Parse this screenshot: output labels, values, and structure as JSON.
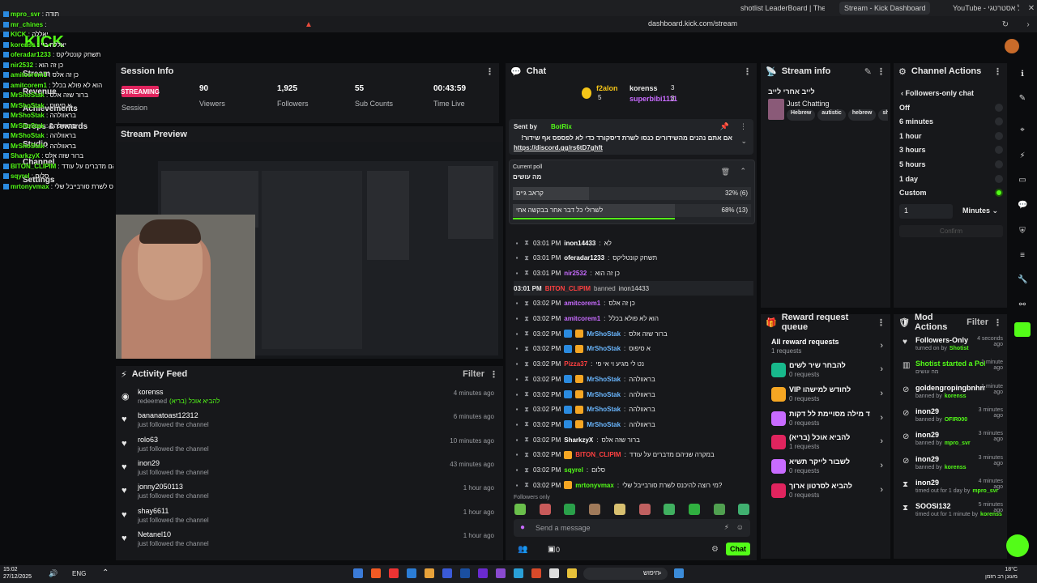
{
  "browser": {
    "tabs": [
      {
        "label": "shotlist LeaderBoard | The best Chatti"
      },
      {
        "label": "Stream - Kick Dashboard"
      },
      {
        "label": "YouTube - פריסטייל אסטרטגי"
      }
    ],
    "url": "dashboard.kick.com/stream"
  },
  "session": {
    "title": "Session Info",
    "status": "STREAMING",
    "status_label": "Session",
    "stats": [
      {
        "value": "90",
        "label": "Viewers"
      },
      {
        "value": "1,925",
        "label": "Followers"
      },
      {
        "value": "55",
        "label": "Sub Counts"
      },
      {
        "value": "00:43:59",
        "label": "Time Live"
      }
    ]
  },
  "preview": {
    "title": "Stream Preview"
  },
  "sidebar_overlay": {
    "logo": "KICK",
    "menu": [
      "Stream",
      "Revenue",
      "Achievements",
      "Drops & rewards",
      "Studio",
      "Channel",
      "Settings"
    ],
    "lines": [
      {
        "user": "mpro_svr",
        "text": "תודה"
      },
      {
        "user": "mr_chines",
        "text": ""
      },
      {
        "user": "KICK",
        "text": "יאללה"
      },
      {
        "user": "korenss",
        "text": "יאללה ביי"
      },
      {
        "user": "oferadar1233",
        "text": "תשחק קונטליקס"
      },
      {
        "user": "nir2532",
        "text": "כן זה הוא"
      },
      {
        "user": "amitcorem1",
        "text": "כן זה אלס"
      },
      {
        "user": "amitcorem1",
        "text": "הוא לא פולא בכלל"
      },
      {
        "user": "MrShoStak",
        "text": "ברור שזה אלס"
      },
      {
        "user": "MrShoStak",
        "text": "א סיפוס"
      },
      {
        "user": "MrShoStak",
        "text": "בראוולהה"
      },
      {
        "user": "MrShoStak",
        "text": "בראוולהה"
      },
      {
        "user": "MrShoStak",
        "text": "בראוולהה"
      },
      {
        "user": "MrShoStak",
        "text": "בראוולהה"
      },
      {
        "user": "SharkzyX",
        "text": "ברור שזה אלס"
      },
      {
        "user": "BITON_CLIPIM",
        "text": "במקרה שניהם מדברים על עודד"
      },
      {
        "user": "sqyrel",
        "text": "סלום"
      },
      {
        "user": "mrtonyvmax",
        "text": "מי רוצה להיכנס לשרת סורבייבל שלי?"
      }
    ]
  },
  "activity": {
    "title": "Activity Feed",
    "filter": "Filter",
    "items": [
      {
        "name": "korenss",
        "sub": "redeemed",
        "reward": "להביא אוכל (בריא)",
        "time": "4 minutes ago"
      },
      {
        "name": "bananatoast12312",
        "sub": "just followed the channel",
        "time": "6 minutes ago"
      },
      {
        "name": "rolo63",
        "sub": "just followed the channel",
        "time": "10 minutes ago"
      },
      {
        "name": "inon29",
        "sub": "just followed the channel",
        "time": "43 minutes ago"
      },
      {
        "name": "jonny2050113",
        "sub": "just followed the channel",
        "time": "1 hour ago"
      },
      {
        "name": "shay6611",
        "sub": "just followed the channel",
        "time": "1 hour ago"
      },
      {
        "name": "Netanel10",
        "sub": "just followed the channel",
        "time": "1 hour ago"
      }
    ]
  },
  "chat": {
    "title": "Chat",
    "leaderboard": [
      {
        "name": "f2alon",
        "count": "5"
      },
      {
        "name": "korenss",
        "count": "3"
      },
      {
        "name": "superbibi1111",
        "count": "3"
      }
    ],
    "pinned": {
      "sent_by": "Sent by",
      "bot": "BotRix",
      "text": "!אם אתם נהנים מהשידורים כנסו לשרת דיסקורד כדי לא לפספס אף שידור",
      "link": "https://discord.gg/rs6tD7ghft"
    },
    "poll": {
      "label": "Current poll",
      "question": "מה עושים",
      "options": [
        {
          "text": "קראב גיים",
          "result": "32% (6)",
          "pct": 32
        },
        {
          "text": "לשרולי כל דבר אחר בבקשה אחי",
          "result": "68% (13)",
          "pct": 68
        }
      ]
    },
    "messages": [
      {
        "time": "03:01 PM",
        "user": "inon14433",
        "color": "#ffffff",
        "text": "לא",
        "badges": []
      },
      {
        "time": "03:01 PM",
        "user": "oferadar1233",
        "color": "#ffffff",
        "text": "תשחק קונטליקס",
        "badges": []
      },
      {
        "time": "03:01 PM",
        "user": "nir2532",
        "color": "#c86bff",
        "text": "כן זה הוא",
        "badges": []
      },
      {
        "system": true,
        "time": "03:01 PM",
        "actor": "BITON_CLIPIM",
        "action": "banned",
        "target": "inon14433"
      },
      {
        "time": "03:02 PM",
        "user": "amitcorem1",
        "color": "#c86bff",
        "text": "כן זה אלס",
        "badges": []
      },
      {
        "time": "03:02 PM",
        "user": "amitcorem1",
        "color": "#c86bff",
        "text": "הוא לא פולא בכלל",
        "badges": []
      },
      {
        "time": "03:02 PM",
        "user": "MrShoStak",
        "color": "#6ab7ff",
        "text": "ברור שזה אלס",
        "badges": [
          "b",
          "o"
        ]
      },
      {
        "time": "03:02 PM",
        "user": "MrShoStak",
        "color": "#6ab7ff",
        "text": "א סיפוס",
        "badges": [
          "b",
          "o"
        ]
      },
      {
        "time": "03:02 PM",
        "user": "Pizza37",
        "color": "#ff4040",
        "text": "נט לי מגיע וי אי פי",
        "badges": []
      },
      {
        "time": "03:02 PM",
        "user": "MrShoStak",
        "color": "#6ab7ff",
        "text": "בראוולהה",
        "badges": [
          "b",
          "o"
        ]
      },
      {
        "time": "03:02 PM",
        "user": "MrShoStak",
        "color": "#6ab7ff",
        "text": "בראוולהה",
        "badges": [
          "b",
          "o"
        ]
      },
      {
        "time": "03:02 PM",
        "user": "MrShoStak",
        "color": "#6ab7ff",
        "text": "בראוולהה",
        "badges": [
          "b",
          "o"
        ]
      },
      {
        "time": "03:02 PM",
        "user": "MrShoStak",
        "color": "#6ab7ff",
        "text": "בראוולהה",
        "badges": [
          "b",
          "o"
        ]
      },
      {
        "time": "03:02 PM",
        "user": "SharkzyX",
        "color": "#ffffff",
        "text": "ברור שזה אלס",
        "badges": []
      },
      {
        "time": "03:02 PM",
        "user": "BITON_CLIPIM",
        "color": "#ff4040",
        "text": "במקרה שניהם מדברים על עודד",
        "badges": [
          "o"
        ]
      },
      {
        "time": "03:02 PM",
        "user": "sqyrel",
        "color": "#53fc18",
        "text": "סלום",
        "badges": []
      },
      {
        "time": "03:02 PM",
        "user": "mrtonyvmax",
        "color": "#53fc18",
        "text": "מי רוצה להיכנס לשרת סורבייבל שלי?",
        "badges": [
          "o"
        ]
      }
    ],
    "followers_only": "Followers only",
    "placeholder": "Send a message",
    "count": "0",
    "send": "Chat"
  },
  "stream_info": {
    "title": "Stream info",
    "stream_title": "לייב אחרי לייב",
    "category": "Just Chatting",
    "tags": [
      "Hebrew",
      "autistic",
      "hebrew",
      "sh"
    ]
  },
  "channel_actions": {
    "title": "Channel Actions",
    "sub": "Followers-only chat",
    "options": [
      "Off",
      "6 minutes",
      "1 hour",
      "3 hours",
      "5 hours",
      "1 day",
      "Custom"
    ],
    "selected": "Custom",
    "custom_value": "1",
    "unit": "Minutes",
    "confirm": "Confirm"
  },
  "reward_queue": {
    "title": "Reward request queue",
    "all": {
      "name": "All reward requests",
      "sub": "1 requests"
    },
    "items": [
      {
        "name": "להבחר שיר לשים",
        "sub": "0 requests",
        "color": "#18b98c"
      },
      {
        "name": "VIP לחודש למישהו",
        "sub": "0 requests",
        "color": "#f5a623"
      },
      {
        "name": "להגיד מילה מסויימת לל דקות",
        "sub": "0 requests",
        "color": "#c86bff"
      },
      {
        "name": "להביא אוכל (בריא)",
        "sub": "1 requests",
        "color": "#e0245e"
      },
      {
        "name": "לשבור לייקר תשיא",
        "sub": "0 requests",
        "color": "#c86bff"
      },
      {
        "name": "להביא לסרטון ארוך",
        "sub": "0 requests",
        "color": "#e0245e"
      }
    ]
  },
  "mod_actions": {
    "title": "Mod Actions",
    "filter": "Filter",
    "items": [
      {
        "icon": "heart",
        "name": "Followers-Only",
        "sub": "turned on by",
        "by": "Shotist",
        "time": "4 seconds ago"
      },
      {
        "icon": "poll",
        "name": "Shotist started a Poll",
        "sub": "מה עושים",
        "by": "",
        "time": "1 minute ago"
      },
      {
        "icon": "ban",
        "name": "goldengropingbnhmlb",
        "sub": "banned by",
        "by": "korenss",
        "time": "1 minute ago"
      },
      {
        "icon": "ban",
        "name": "inon29",
        "sub": "banned by",
        "by": "OFIR000",
        "time": "3 minutes ago"
      },
      {
        "icon": "ban",
        "name": "inon29",
        "sub": "banned by",
        "by": "mpro_svr",
        "time": "3 minutes ago"
      },
      {
        "icon": "ban",
        "name": "inon29",
        "sub": "banned by",
        "by": "korenss",
        "time": "3 minutes ago"
      },
      {
        "icon": "timeout",
        "name": "inon29",
        "sub": "timed out for 1 day by",
        "by": "mpro_svr",
        "time": "4 minutes ago"
      },
      {
        "icon": "timeout",
        "name": "SOOSI132",
        "sub": "timed out for 1 minute by",
        "by": "korenss",
        "time": "5 minutes ago"
      }
    ]
  },
  "taskbar": {
    "time": "15:02",
    "date": "27/12/2025",
    "lang": "ENG",
    "search": "חיפוש",
    "weather": "18°C",
    "weather_sub": "מעונן רב הזמן"
  }
}
